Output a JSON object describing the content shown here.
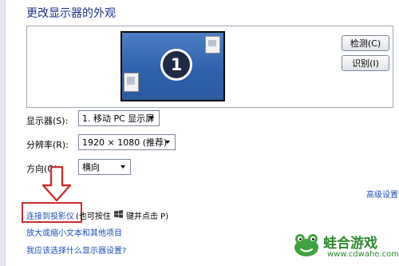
{
  "page": {
    "title": "更改显示器的外观"
  },
  "preview": {
    "monitor_number": "1",
    "detect_button": "检测(C)",
    "identify_button": "识别(I)"
  },
  "settings": {
    "display_label": "显示器(S):",
    "display_value": "1. 移动 PC 显示屏",
    "resolution_label": "分辨率(R):",
    "resolution_value": "1920 × 1080 (推荐)",
    "orientation_label": "方向(O):",
    "orientation_value": "横向"
  },
  "links": {
    "advanced_settings": "高级设置",
    "connect_projector": "连接到投影仪",
    "shortcut_prefix": "(也可按住",
    "shortcut_suffix": "键并点击 P)",
    "enlarge_text": "放大或缩小文本和其他项目",
    "which_settings": "我应该选择什么显示器设置?"
  },
  "annotation": {
    "arrow_color": "#c83030",
    "box_color": "#c83030"
  },
  "watermark": {
    "title": "蛙合游戏",
    "url": "www.cdwahe.com"
  },
  "colors": {
    "title_blue": "#1e3287",
    "link_blue": "#1a4fb5",
    "desktop_blue": "#2f61ad",
    "watermark_green": "#2e8a2e"
  }
}
